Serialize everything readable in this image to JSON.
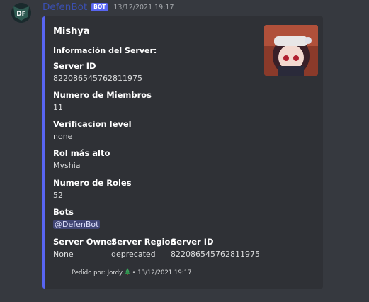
{
  "message": {
    "author_initials": "DF",
    "author_name": "DefenBot",
    "bot_tag": "BOT",
    "timestamp": "13/12/2021 19:17"
  },
  "embed": {
    "accent_color": "#5865f2",
    "title": "Mishya",
    "description": "Información del Server:",
    "fields": [
      {
        "name": "Server ID",
        "value": "822086545762811975"
      },
      {
        "name": "Numero de Miembros",
        "value": "11"
      },
      {
        "name": "Verificacion level",
        "value": "none"
      },
      {
        "name": "Rol más alto",
        "value": "Myshia"
      },
      {
        "name": "Numero de Roles",
        "value": "52"
      },
      {
        "name": "Bots",
        "value": "@DefenBot"
      }
    ],
    "inline_fields": [
      {
        "name": "Server Owner",
        "value": "None"
      },
      {
        "name": "Server Region",
        "value": "deprecated"
      },
      {
        "name": "Server ID",
        "value": "822086545762811975"
      }
    ],
    "footer": {
      "text": "Pedido por: Jordy",
      "timestamp": "13/12/2021 19:17"
    }
  }
}
